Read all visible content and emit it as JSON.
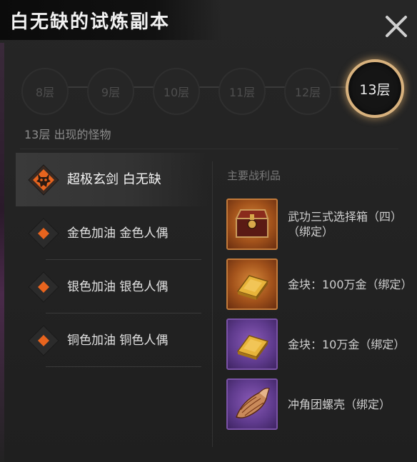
{
  "title": "白无缺的试炼副本",
  "floors": [
    "8层",
    "9层",
    "10层",
    "11层",
    "12层",
    "13层"
  ],
  "active_floor_index": 5,
  "floor_caption": "13层 出现的怪物",
  "monsters": [
    {
      "name": "超极玄剑 白无缺",
      "icon": "demon-skull-icon",
      "selected": true
    },
    {
      "name": "金色加油 金色人偶",
      "icon": "diamond-marker-icon",
      "selected": false
    },
    {
      "name": "银色加油 银色人偶",
      "icon": "diamond-marker-icon",
      "selected": false
    },
    {
      "name": "铜色加油 铜色人偶",
      "icon": "diamond-marker-icon",
      "selected": false
    }
  ],
  "loot_title": "主要战利品",
  "loot": [
    {
      "name": "武功三式选择箱（四）（绑定）",
      "icon": "treasure-chest-icon",
      "rarity": "orange"
    },
    {
      "name": "金块：100万金（绑定）",
      "icon": "gold-bar-icon",
      "rarity": "orange"
    },
    {
      "name": "金块：10万金（绑定）",
      "icon": "gold-bar-icon",
      "rarity": "purple"
    },
    {
      "name": "冲角团螺壳（绑定）",
      "icon": "conch-shell-icon",
      "rarity": "purple"
    }
  ],
  "colors": {
    "accent": "#e8641e",
    "active_ring": "#d8b27e",
    "rarity_orange": "#c27a3a",
    "rarity_purple": "#7a52a6"
  }
}
